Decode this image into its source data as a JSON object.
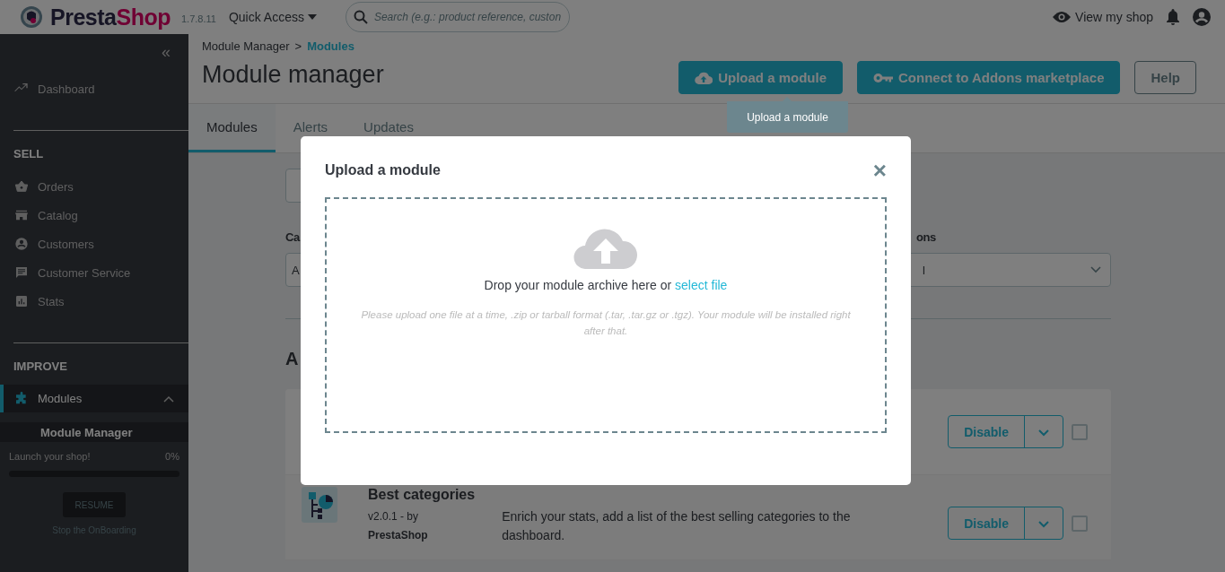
{
  "header": {
    "logo": [
      "Presta",
      "Shop"
    ],
    "version": "1.7.8.11",
    "quick_access": "Quick Access",
    "search": {
      "placeholder": "Search (e.g.: product reference, custon"
    },
    "view_shop": "View my shop"
  },
  "sidebar": {
    "collapse": "«",
    "items": [
      {
        "kind": "item",
        "label": "Dashboard",
        "selected": false
      },
      {
        "kind": "section",
        "label": "SELL"
      },
      {
        "kind": "item",
        "label": "Orders",
        "selected": false
      },
      {
        "kind": "item",
        "label": "Catalog",
        "selected": false
      },
      {
        "kind": "item",
        "label": "Customers",
        "selected": false
      },
      {
        "kind": "item",
        "label": "Customer Service",
        "selected": false
      },
      {
        "kind": "item",
        "label": "Stats",
        "selected": false
      },
      {
        "kind": "section",
        "label": "IMPROVE"
      },
      {
        "kind": "item",
        "label": "Modules",
        "selected": true,
        "expanded": true,
        "children": [
          {
            "label": "Module Manager",
            "selected": true
          }
        ]
      }
    ],
    "onboarding": {
      "title": "Launch your shop!",
      "percent": "0%",
      "level": 0,
      "button": "RESUME",
      "stop_link": "Stop the OnBoarding"
    }
  },
  "page": {
    "breadcrumb": [
      "Module Manager",
      "Modules"
    ],
    "breadcrumb_separator": ">",
    "title": "Module manager",
    "buttons": [
      {
        "kind": "upload",
        "label": "Upload a module"
      },
      {
        "kind": "connect",
        "label": "Connect to Addons marketplace"
      },
      {
        "kind": "help",
        "label": "Help"
      }
    ],
    "tooltip": "Upload a module",
    "tabs": [
      {
        "label": "Modules",
        "selected": true
      },
      {
        "label": "Alerts",
        "selected": false
      },
      {
        "label": "Updates",
        "selected": false
      }
    ],
    "filters": [
      {
        "label": "Ca",
        "value": "A"
      },
      {
        "label": "ons",
        "value": "l"
      }
    ],
    "section_title": "A",
    "modules": [
      {
        "kind": "partial",
        "action": "Disable",
        "checked": false
      },
      {
        "kind": "full",
        "name": "Best categories",
        "version": "v2.0.1 - by",
        "author": "PrestaShop",
        "description": "Enrich your stats, add a list of the best selling categories to the dashboard.",
        "action": "Disable",
        "checked": false
      }
    ]
  },
  "modal": {
    "title": "Upload a module",
    "close": "×",
    "drop_text": "Drop your module archive here or ",
    "select_link": "select file",
    "hint": "Please upload one file at a time, .zip or tarball format (.tar, .tar.gz or .tgz). Your module will be installed right after that."
  }
}
